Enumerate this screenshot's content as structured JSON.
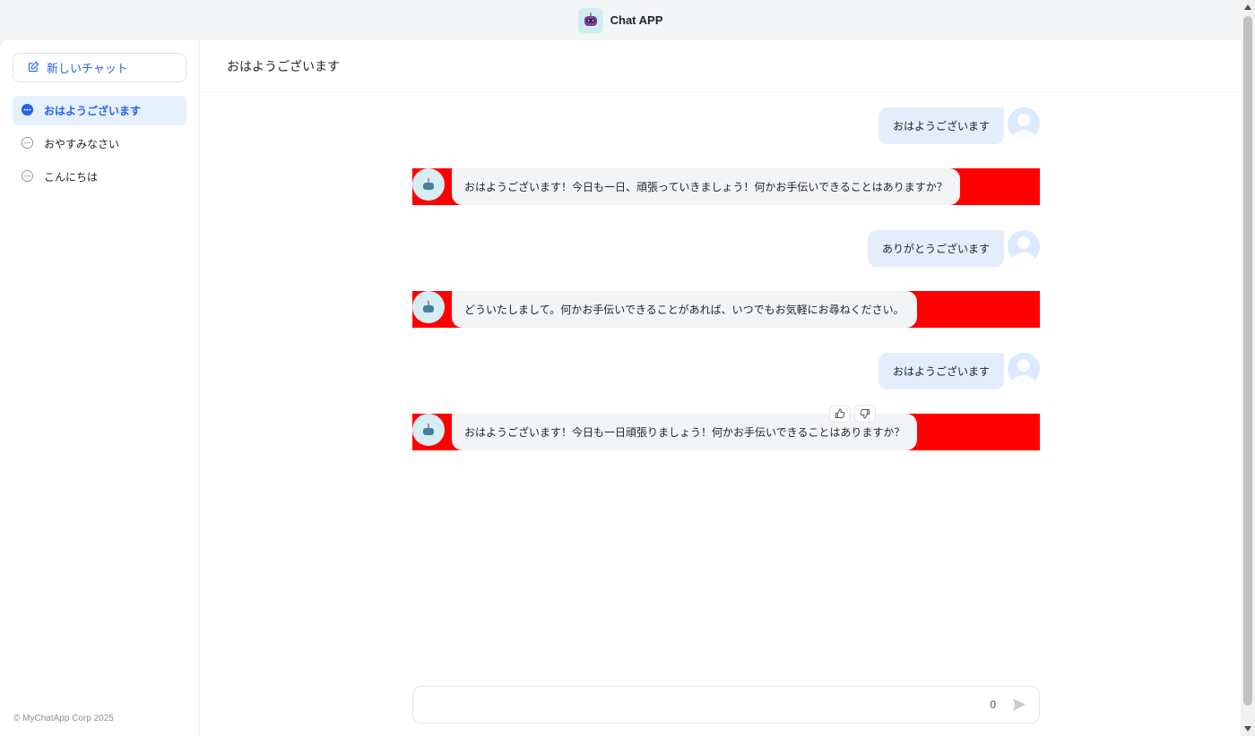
{
  "app": {
    "title": "Chat APP",
    "logo_icon": "robot-icon"
  },
  "sidebar": {
    "new_chat_label": "新しいチャット",
    "conversations": [
      {
        "label": "おはようございます",
        "active": true
      },
      {
        "label": "おやすみなさい",
        "active": false
      },
      {
        "label": "こんにちは",
        "active": false
      }
    ],
    "footer": "© MyChatApp Corp 2025"
  },
  "main": {
    "header_title": "おはようございます",
    "messages": [
      {
        "role": "user",
        "text": "おはようございます"
      },
      {
        "role": "assistant",
        "text": "おはようございます！今日も一日、頑張っていきましょう！何かお手伝いできることはありますか？"
      },
      {
        "role": "user",
        "text": "ありがとうございます"
      },
      {
        "role": "assistant",
        "text": "どういたしまして。何かお手伝いできることがあれば、いつでもお気軽にお尋ねください。"
      },
      {
        "role": "user",
        "text": "おはようございます"
      },
      {
        "role": "assistant",
        "text": "おはようございます！今日も一日頑張りましょう！何かお手伝いできることはありますか？"
      }
    ],
    "composer": {
      "value": "",
      "placeholder": "",
      "char_count": "0"
    }
  },
  "colors": {
    "accent": "#2563eb",
    "ai_row_highlight": "#ff0000",
    "user_bubble": "#e4edfb",
    "ai_bubble": "#f3f4f6"
  }
}
